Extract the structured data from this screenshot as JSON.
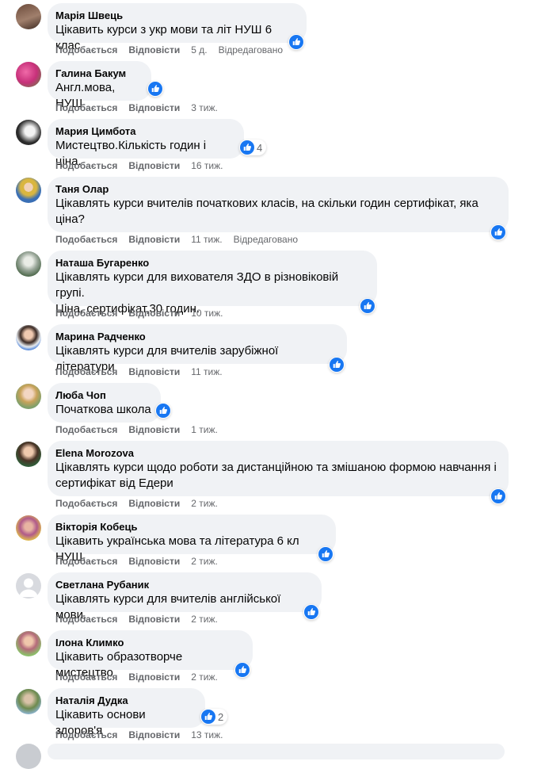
{
  "labels": {
    "like": "Подобається",
    "reply": "Відповісти",
    "edited": "Відредаговано"
  },
  "colors": {
    "like_blue": "#1877f2",
    "bubble_bg": "#f0f2f5",
    "meta_gray": "#65676b"
  },
  "comments": [
    {
      "author": "Марія Швець",
      "lines": [
        "Цікавить курси з укр мови та літ НУШ 6 клас"
      ],
      "time": "5 д.",
      "edited": true,
      "reactions": ""
    },
    {
      "author": "Галина Бакум",
      "lines": [
        "Англ.мова, НУШ"
      ],
      "time": "3 тиж.",
      "edited": false,
      "reactions": ""
    },
    {
      "author": "Мария Цимбота",
      "lines": [
        "Мистецтво.Кількість годин і ціна."
      ],
      "time": "16 тиж.",
      "edited": false,
      "reactions": "4"
    },
    {
      "author": "Таня Олар",
      "lines": [
        "Цікавлять курси вчителів початкових класів, на скільки годин сертифікат, яка",
        "ціна?"
      ],
      "time": "11 тиж.",
      "edited": true,
      "reactions": ""
    },
    {
      "author": "Наташа Бугаренко",
      "lines": [
        "Цікавлять курси для вихователя ЗДО в різновіковій групі.",
        "Ціна, сертифікат,30 годин."
      ],
      "time": "10 тиж.",
      "edited": false,
      "reactions": ""
    },
    {
      "author": "Марина Радченко",
      "lines": [
        "Цікавлять курси для вчителів зарубіжної літератури"
      ],
      "time": "11 тиж.",
      "edited": false,
      "reactions": ""
    },
    {
      "author": "Люба Чоп",
      "lines": [
        "Початкова школа"
      ],
      "time": "1 тиж.",
      "edited": false,
      "reactions": ""
    },
    {
      "author": "Elena Morozova",
      "lines": [
        "Цікавлять курси щодо роботи за дистанційною та змішаною формою навчання і",
        "сертифікат від Едери"
      ],
      "time": "2 тиж.",
      "edited": false,
      "reactions": ""
    },
    {
      "author": "Вікторія Кобець",
      "lines": [
        "Цікавить українська мова та література 6 кл НУШ."
      ],
      "time": "2 тиж.",
      "edited": false,
      "reactions": ""
    },
    {
      "author": "Светлана Рубаник",
      "lines": [
        "Цікавлять курси для вчителів англійської мови."
      ],
      "time": "2 тиж.",
      "edited": false,
      "reactions": ""
    },
    {
      "author": "Ілона Климко",
      "lines": [
        "Цікавить образотворче мистецтво"
      ],
      "time": "2 тиж.",
      "edited": false,
      "reactions": ""
    },
    {
      "author": "Наталія Дудка",
      "lines": [
        "Цікавить основи здоров'я"
      ],
      "time": "13 тиж.",
      "edited": false,
      "reactions": "2"
    }
  ]
}
